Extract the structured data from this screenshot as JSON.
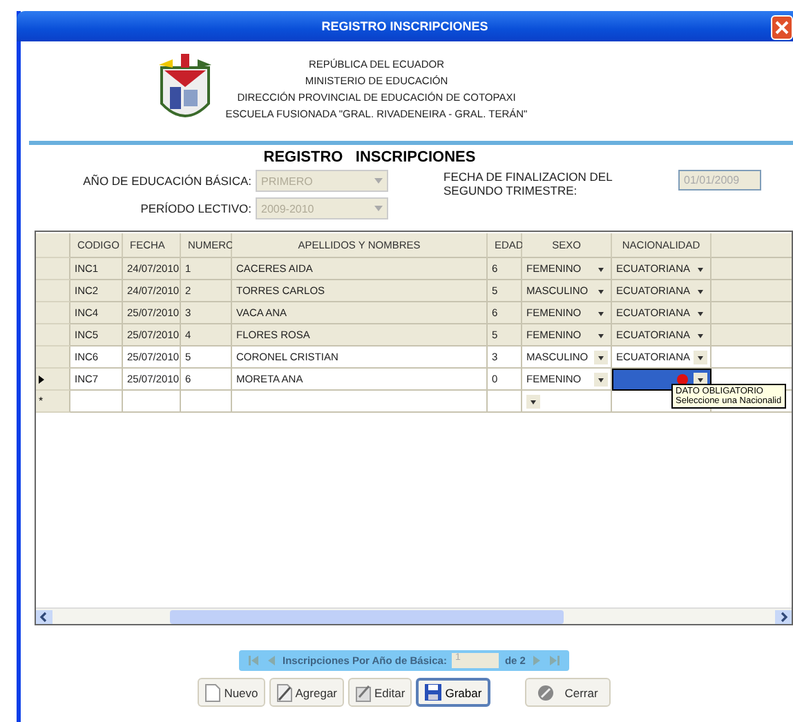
{
  "window": {
    "title": "REGISTRO INSCRIPCIONES"
  },
  "header": {
    "lines": [
      "REPÚBLICA DEL ECUADOR",
      "MINISTERIO DE EDUCACIÓN",
      "DIRECCIÓN PROVINCIAL DE EDUCACIÓN DE COTOPAXI",
      "ESCUELA FUSIONADA \"GRAL. RIVADENEIRA - GRAL. TERÁN\""
    ]
  },
  "form": {
    "title": "REGISTRO   INSCRIPCIONES",
    "fields": [
      {
        "label": "AÑO DE EDUCACIÓN BÁSICA:",
        "value": "PRIMERO",
        "disabled": true
      },
      {
        "label": "PERÍODO LECTIVO:",
        "value": "2009-2010",
        "disabled": true
      }
    ],
    "date": {
      "label": "FECHA DE FINALIZACION DEL SEGUNDO TRIMESTRE:",
      "value": "01/01/2009",
      "disabled": true
    }
  },
  "table": {
    "columns": [
      "CODIGO",
      "FECHA",
      "NUMERO",
      "APELLIDOS  Y  NOMBRES",
      "EDAD",
      "SEXO",
      "NACIONALIDAD"
    ],
    "rows": [
      {
        "codigo": "INC1",
        "fecha": "24/07/2010",
        "numero": "1",
        "nombres": "CACERES AIDA",
        "edad": "6",
        "sexo": "FEMENINO",
        "nacionalidad": "ECUATORIANA",
        "saved": true,
        "current": false,
        "error": false
      },
      {
        "codigo": "INC2",
        "fecha": "24/07/2010",
        "numero": "2",
        "nombres": "TORRES CARLOS",
        "edad": "5",
        "sexo": "MASCULINO",
        "nacionalidad": "ECUATORIANA",
        "saved": true,
        "current": false,
        "error": false
      },
      {
        "codigo": "INC4",
        "fecha": "25/07/2010",
        "numero": "3",
        "nombres": "VACA ANA",
        "edad": "6",
        "sexo": "FEMENINO",
        "nacionalidad": "ECUATORIANA",
        "saved": true,
        "current": false,
        "error": false
      },
      {
        "codigo": "INC5",
        "fecha": "25/07/2010",
        "numero": "4",
        "nombres": "FLORES ROSA",
        "edad": "5",
        "sexo": "FEMENINO",
        "nacionalidad": "ECUATORIANA",
        "saved": true,
        "current": false,
        "error": false
      },
      {
        "codigo": "INC6",
        "fecha": "25/07/2010",
        "numero": "5",
        "nombres": "CORONEL CRISTIAN",
        "edad": "3",
        "sexo": "MASCULINO",
        "nacionalidad": "ECUATORIANA",
        "saved": false,
        "current": false,
        "error": false
      },
      {
        "codigo": "INC7",
        "fecha": "25/07/2010",
        "numero": "6",
        "nombres": "MORETA ANA",
        "edad": "0",
        "sexo": "FEMENINO",
        "saved": false,
        "current": true,
        "error": true
      }
    ],
    "new_row_marker": "*",
    "tooltip": {
      "title": "DATO OBLIGATORIO",
      "text": "Seleccione una Nacionalid"
    }
  },
  "navigator": {
    "label": "Inscripciones Por Año de Básica:",
    "value": "1",
    "total": "de 2"
  },
  "buttons": [
    {
      "label": "Nuevo",
      "kind": "new",
      "focused": false
    },
    {
      "label": "Agregar",
      "kind": "add",
      "focused": false
    },
    {
      "label": "Editar",
      "kind": "edit",
      "focused": false
    },
    {
      "label": "Grabar",
      "kind": "save",
      "focused": true
    },
    {
      "label": "Cerrar",
      "kind": "close",
      "focused": false
    }
  ]
}
